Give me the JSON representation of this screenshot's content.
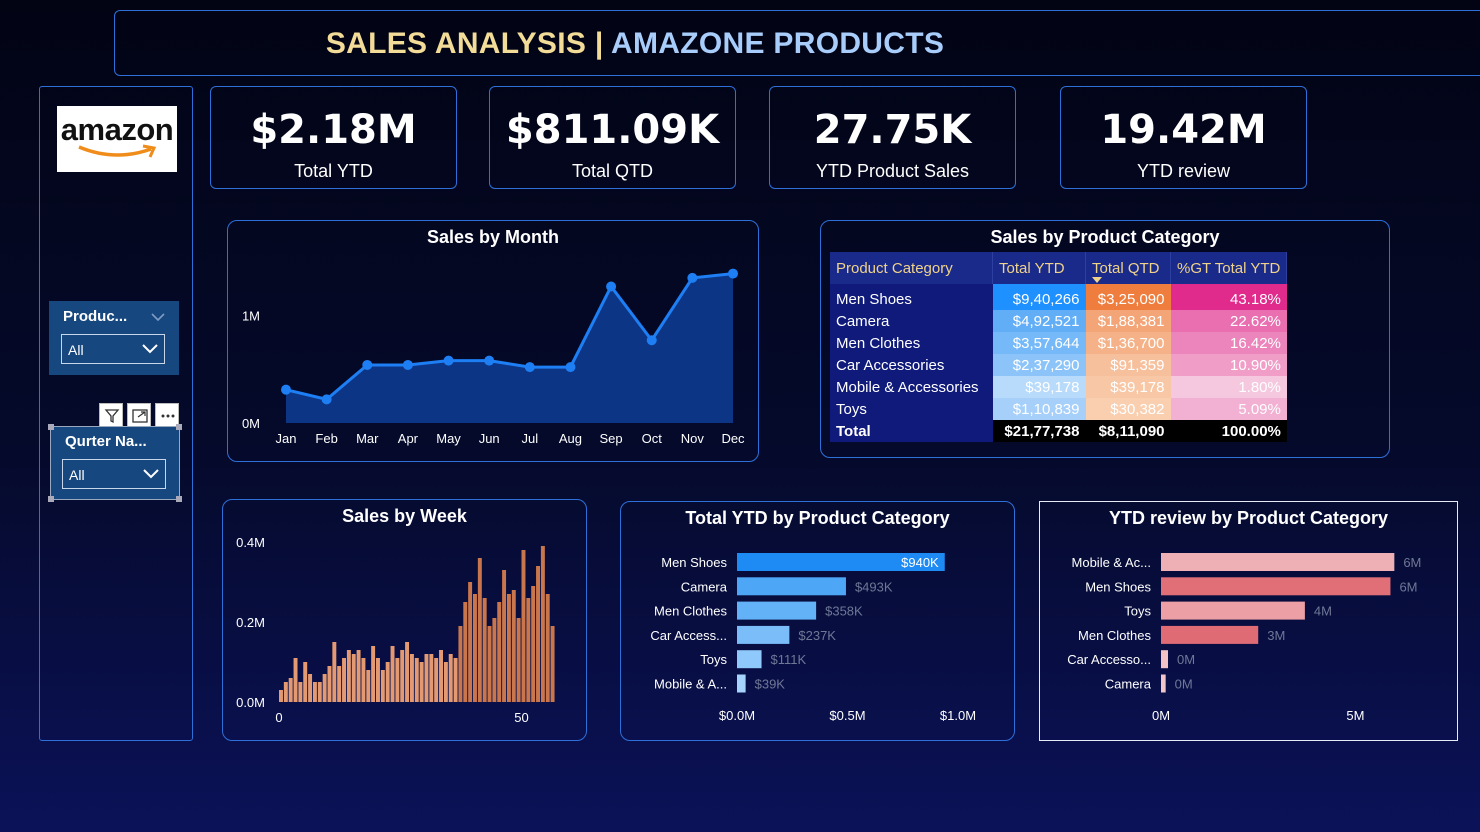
{
  "header": {
    "title_left": "SALES ANALYSIS | ",
    "title_right": "AMAZONE PRODUCTS"
  },
  "sidebar": {
    "logo_text": "amazon",
    "slicer_product": {
      "title": "Produc...",
      "value": "All"
    },
    "slicer_quarter": {
      "title": "Qurter Na...",
      "value": "All"
    },
    "toolbar_icons": [
      "filter-icon",
      "focus-mode-icon",
      "more-options-icon"
    ]
  },
  "kpis": [
    {
      "value": "$2.18M",
      "label": "Total YTD"
    },
    {
      "value": "$811.09K",
      "label": "Total QTD"
    },
    {
      "value": "27.75K",
      "label": "YTD Product Sales"
    },
    {
      "value": "19.42M",
      "label": "YTD review"
    }
  ],
  "colors": {
    "accent": "#2e6fd8",
    "line": "#1e7ff5",
    "bars_week": "#e39a72",
    "bars_ytd": "#1e8bf5",
    "bars_review": "#e37a82"
  },
  "chart_data": [
    {
      "type": "area",
      "title": "Sales by Month",
      "categories": [
        "Jan",
        "Feb",
        "Mar",
        "Apr",
        "May",
        "Jun",
        "Jul",
        "Aug",
        "Sep",
        "Oct",
        "Nov",
        "Dec"
      ],
      "values": [
        0.31,
        0.22,
        0.54,
        0.54,
        0.58,
        0.58,
        0.52,
        0.52,
        1.27,
        0.77,
        1.35,
        1.39
      ],
      "y_ticks": [
        "0M",
        "1M"
      ],
      "ylim": [
        0,
        1.6
      ]
    },
    {
      "type": "bar",
      "title": "Sales by Week",
      "x_ticks": [
        "0",
        "50"
      ],
      "y_ticks": [
        "0.0M",
        "0.2M",
        "0.4M"
      ],
      "ylim": [
        0,
        0.4
      ],
      "values": [
        0.03,
        0.05,
        0.06,
        0.11,
        0.05,
        0.1,
        0.07,
        0.05,
        0.05,
        0.07,
        0.09,
        0.15,
        0.09,
        0.11,
        0.13,
        0.12,
        0.13,
        0.11,
        0.08,
        0.14,
        0.11,
        0.08,
        0.1,
        0.14,
        0.11,
        0.13,
        0.15,
        0.12,
        0.11,
        0.1,
        0.12,
        0.12,
        0.11,
        0.13,
        0.1,
        0.12,
        0.11,
        0.19,
        0.25,
        0.3,
        0.27,
        0.36,
        0.26,
        0.19,
        0.21,
        0.25,
        0.33,
        0.27,
        0.28,
        0.21,
        0.38,
        0.26,
        0.29,
        0.34,
        0.39,
        0.27,
        0.19
      ]
    },
    {
      "type": "bar",
      "title": "Total YTD by Product Category",
      "categories": [
        "Men Shoes",
        "Camera",
        "Men Clothes",
        "Car Access...",
        "Toys",
        "Mobile & A..."
      ],
      "values": [
        0.94,
        0.493,
        0.358,
        0.237,
        0.111,
        0.039
      ],
      "data_labels": [
        "$940K",
        "$493K",
        "$358K",
        "$237K",
        "$111K",
        "$39K"
      ],
      "x_ticks": [
        "$0.0M",
        "$0.5M",
        "$1.0M"
      ],
      "xlim": [
        0,
        1.0
      ]
    },
    {
      "type": "bar",
      "title": "YTD review by Product Category",
      "categories": [
        "Mobile & Ac...",
        "Men Shoes",
        "Toys",
        "Men Clothes",
        "Car Accesso...",
        "Camera"
      ],
      "values": [
        6.0,
        5.9,
        3.7,
        2.5,
        0.18,
        0.12
      ],
      "data_labels": [
        "6M",
        "6M",
        "4M",
        "3M",
        "0M",
        "0M"
      ],
      "x_ticks": [
        "0M",
        "5M"
      ],
      "xlim": [
        0,
        6.3
      ]
    },
    {
      "type": "table",
      "title": "Sales by Product Category",
      "columns": [
        "Product Category",
        "Total YTD",
        "Total QTD",
        "%GT Total YTD"
      ],
      "rows": [
        [
          "Men Shoes",
          "$9,40,266",
          "$3,25,090",
          "43.18%"
        ],
        [
          "Camera",
          "$4,92,521",
          "$1,88,381",
          "22.62%"
        ],
        [
          "Men Clothes",
          "$3,57,644",
          "$1,36,700",
          "16.42%"
        ],
        [
          "Car Accessories",
          "$2,37,290",
          "$91,359",
          "10.90%"
        ],
        [
          "Mobile & Accessories",
          "$39,178",
          "$39,178",
          "1.80%"
        ],
        [
          "Toys",
          "$1,10,839",
          "$30,382",
          "5.09%"
        ]
      ],
      "total": [
        "Total",
        "$21,77,738",
        "$8,11,090",
        "100.00%"
      ]
    }
  ]
}
